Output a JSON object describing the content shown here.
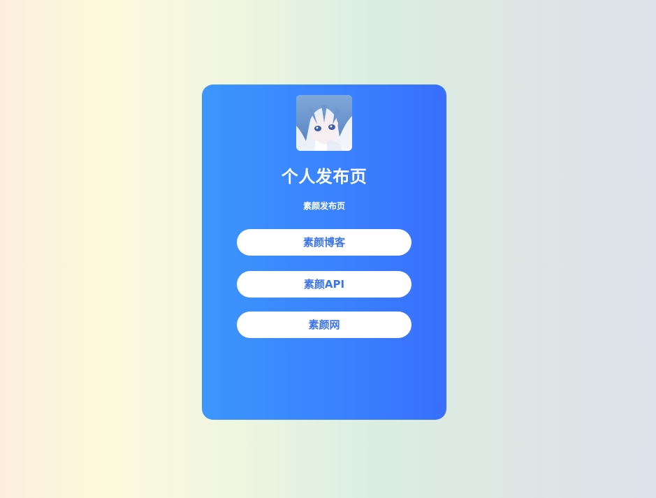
{
  "profile": {
    "title": "个人发布页",
    "subtitle": "素颜发布页",
    "avatar_icon": "anime-avatar-icon"
  },
  "links": [
    {
      "label": "素颜博客"
    },
    {
      "label": "素颜API"
    },
    {
      "label": "素颜网"
    }
  ],
  "colors": {
    "card_gradient_start": "#3d96fd",
    "card_gradient_end": "#386ffd",
    "button_text": "#3c74f0",
    "button_bg": "#ffffff"
  }
}
